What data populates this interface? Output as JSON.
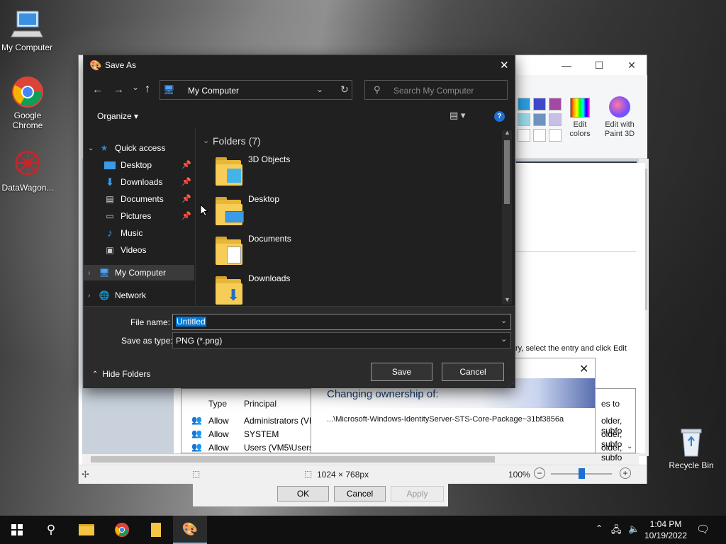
{
  "desktop": {
    "icons": [
      {
        "label": "My Computer"
      },
      {
        "label": "Google Chrome"
      },
      {
        "label": "DataWagon..."
      },
      {
        "label": "Recycle Bin"
      }
    ]
  },
  "paint": {
    "title_controls": {
      "minimize": "—",
      "maximize": "☐",
      "close": "✕",
      "help": "?"
    },
    "ribbon": {
      "edit_colors": "Edit colors",
      "edit_with_paint3d": "Edit with Paint 3D"
    },
    "status": {
      "dimensions": "1024 × 768px",
      "zoom": "100%"
    }
  },
  "security_dialog": {
    "text_fragment": "ry, select the entry and click Edit",
    "columns": [
      "Type",
      "Principal"
    ],
    "rows": [
      {
        "type": "Allow",
        "principal": "Administrators (VM",
        "applies": "older, subfo"
      },
      {
        "type": "Allow",
        "principal": "SYSTEM",
        "applies": "older, subfo"
      },
      {
        "type": "Allow",
        "principal": "Users (VM5\\Users)",
        "applies": "older, subfo"
      }
    ],
    "applies_header": "es to",
    "buttons": {
      "ok": "OK",
      "cancel": "Cancel",
      "apply": "Apply"
    }
  },
  "ownership_popup": {
    "title": "Changing ownership of:",
    "path": "...\\Microsoft-Windows-IdentityServer-STS-Core-Package~31bf3856a",
    "close": "✕"
  },
  "save_as": {
    "title": "Save As",
    "close": "✕",
    "nav": {
      "back": "←",
      "forward": "→",
      "dropdown": "⌄",
      "up": "↑",
      "refresh": "↻"
    },
    "address": "My Computer",
    "search_placeholder": "Search My Computer",
    "toolbar": {
      "organize": "Organize ▾",
      "help": "?"
    },
    "tree": [
      {
        "label": "Quick access",
        "icon": "star-icon",
        "pinned": false
      },
      {
        "label": "Desktop",
        "icon": "desktop-icon",
        "pinned": true
      },
      {
        "label": "Downloads",
        "icon": "download-icon",
        "pinned": true
      },
      {
        "label": "Documents",
        "icon": "documents-icon",
        "pinned": true
      },
      {
        "label": "Pictures",
        "icon": "pictures-icon",
        "pinned": true
      },
      {
        "label": "Music",
        "icon": "music-icon",
        "pinned": false
      },
      {
        "label": "Videos",
        "icon": "videos-icon",
        "pinned": false
      },
      {
        "label": "My Computer",
        "icon": "computer-icon",
        "pinned": false
      },
      {
        "label": "Network",
        "icon": "network-icon",
        "pinned": false
      }
    ],
    "folders_header": "Folders (7)",
    "folders": [
      {
        "name": "3D Objects"
      },
      {
        "name": "Desktop"
      },
      {
        "name": "Documents"
      },
      {
        "name": "Downloads"
      }
    ],
    "file_name_label": "File name:",
    "file_name_value": "Untitled",
    "save_type_label": "Save as type:",
    "save_type_value": "PNG (*.png)",
    "hide_folders": "Hide Folders",
    "save_button": "Save",
    "cancel_button": "Cancel"
  },
  "taskbar": {
    "time": "1:04 PM",
    "date": "10/19/2022"
  },
  "colors": {
    "dialog_bg": "#202020",
    "accent": "#0078d7",
    "selected_tree": "#3a3a3a"
  }
}
